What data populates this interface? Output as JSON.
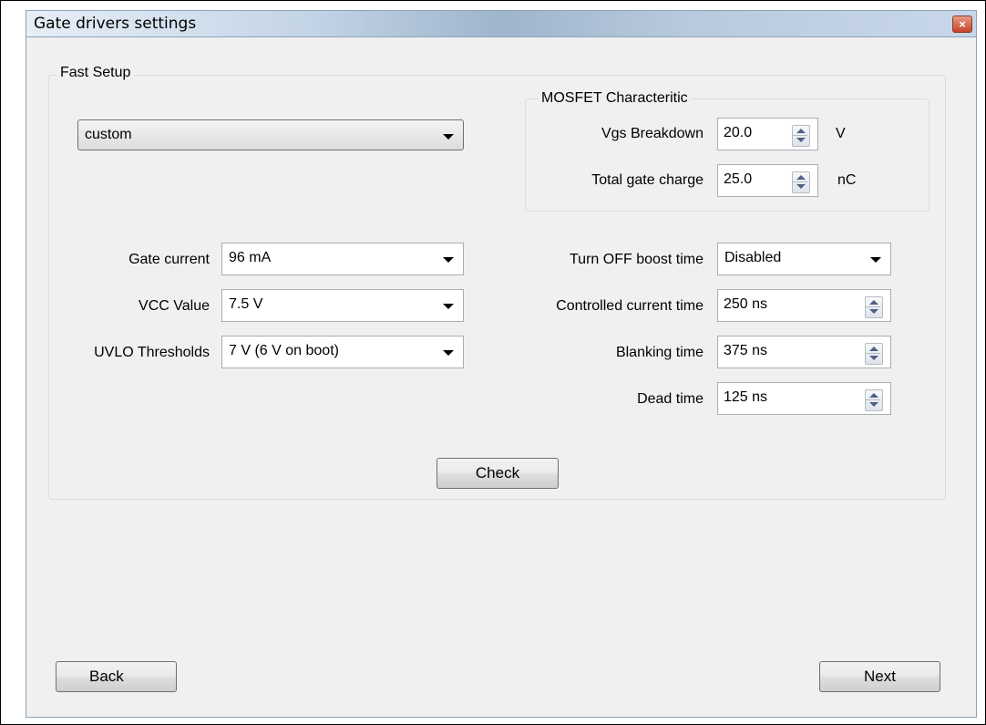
{
  "window": {
    "title": "Gate drivers settings",
    "close_glyph": "×"
  },
  "fast_setup": {
    "title": "Fast Setup",
    "preset": "custom",
    "gate_current": {
      "label": "Gate current",
      "value": "96 mA"
    },
    "vcc_value": {
      "label": "VCC Value",
      "value": "7.5 V"
    },
    "uvlo_thresholds": {
      "label": "UVLO Thresholds",
      "value": "7 V (6 V on boot)"
    },
    "turn_off_boost_time": {
      "label": "Turn OFF boost time",
      "value": "Disabled"
    },
    "controlled_current_time": {
      "label": "Controlled current time",
      "value": "250 ns"
    },
    "blanking_time": {
      "label": "Blanking time",
      "value": "375 ns"
    },
    "dead_time": {
      "label": "Dead time",
      "value": "125 ns"
    },
    "check_label": "Check"
  },
  "mosfet": {
    "title": "MOSFET Characteritic",
    "vgs_breakdown": {
      "label": "Vgs Breakdown",
      "value": "20.0",
      "unit": "V"
    },
    "total_gate_charge": {
      "label": "Total gate charge",
      "value": "25.0",
      "unit": "nC"
    }
  },
  "footer": {
    "back_label": "Back",
    "next_label": "Next"
  }
}
